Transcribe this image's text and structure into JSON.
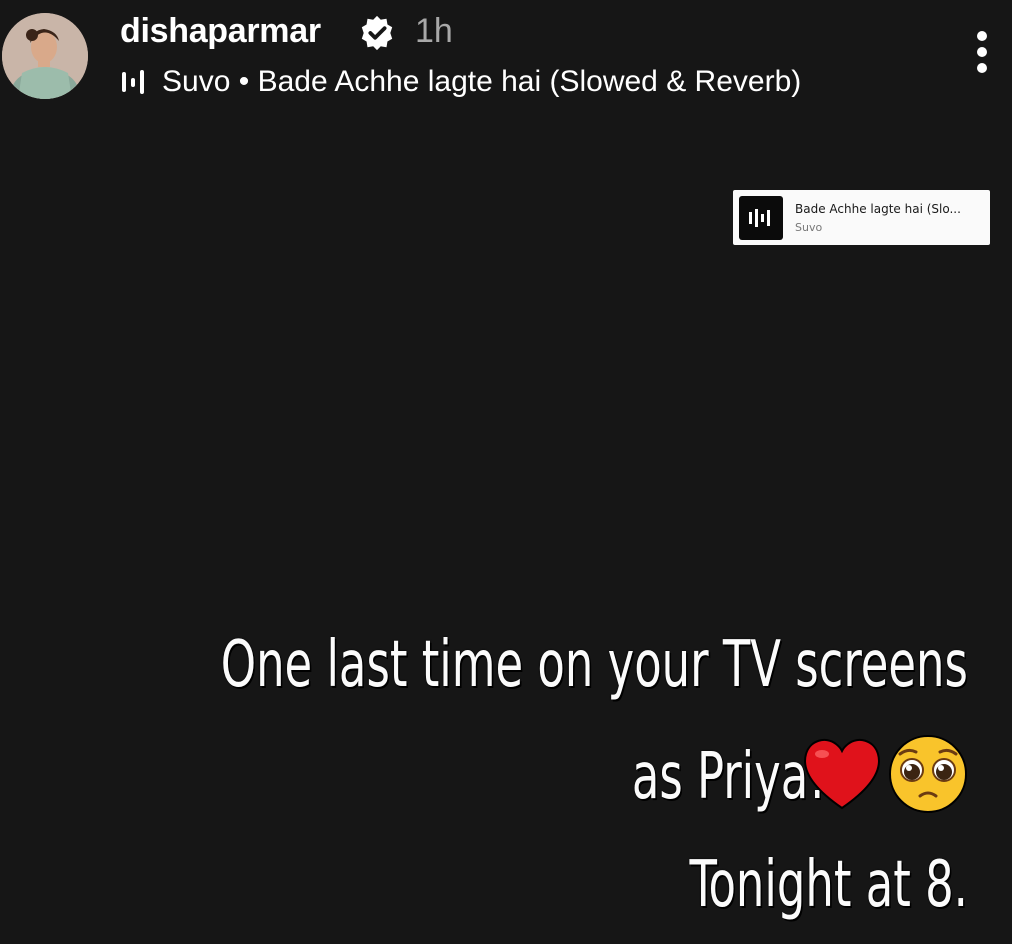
{
  "header": {
    "username": "dishaparmar",
    "verified_icon": "verified-badge-icon",
    "time": "1h",
    "music": {
      "icon": "audio-bars-icon",
      "artist": "Suvo",
      "separator": " • ",
      "song": "Bade Achhe lagte hai (Slowed & Reverb)"
    },
    "more_icon": "more-vertical-icon"
  },
  "music_sticker": {
    "title": "Bade Achhe lagte hai (Slo...",
    "artist": "Suvo"
  },
  "caption": {
    "line1": "One last time on your TV screens",
    "line2": "as Priya!",
    "line3": "Tonight at 8.",
    "emojis": [
      "red-heart-emoji",
      "pleading-face-emoji"
    ]
  },
  "colors": {
    "background": "#161616",
    "time_gray": "#a8a8a8",
    "heart_red": "#e0121b",
    "emoji_yellow": "#f9c42b"
  }
}
